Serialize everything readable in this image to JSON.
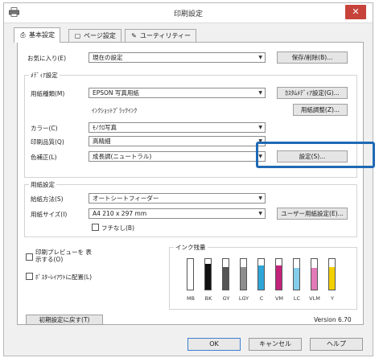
{
  "window": {
    "title": "印刷設定",
    "close_glyph": "✕"
  },
  "tabs": [
    {
      "label": "基本設定",
      "icon": "printer-icon"
    },
    {
      "label": "ページ設定",
      "icon": "page-icon"
    },
    {
      "label": "ユーティリティー",
      "icon": "wrench-icon"
    }
  ],
  "favorites": {
    "label": "お気に入り(E)",
    "value": "現在の設定",
    "save_button": "保存/削除(B)..."
  },
  "media": {
    "group_title": "ﾒﾃﾞｨｱ設定",
    "paper_type_label": "用紙種類(M)",
    "paper_type_value": "EPSON 写真用紙",
    "custom_media_button": "ｶｽﾀﾑﾒﾃﾞｨｱ設定(G)...",
    "sub_label": "ｲﾝｸｼｮｯﾄﾌﾞﾗｯｸｲﾝｸ",
    "paper_adjust_button": "用紙調整(Z)...",
    "color_label": "カラー(C)",
    "color_value": "ﾓﾉｸﾛ写真",
    "quality_label": "印刷品質(Q)",
    "quality_value": "高精細",
    "correction_label": "色補正(L)",
    "correction_value": "成長調(ニュートラル)",
    "settings_button": "設定(S)..."
  },
  "paper": {
    "group_title": "用紙設定",
    "feed_label": "給紙方法(S)",
    "feed_value": "オートシートフィーダー",
    "size_label": "用紙サイズ(I)",
    "size_value": "A4 210 x 297 mm",
    "user_size_button": "ユーザー用紙設定(E)...",
    "borderless_label": "フチなし(B)"
  },
  "options": {
    "preview_label": "印刷プレビューを 表示する(O)",
    "layout_label": "ﾎﾟｽﾀｰﾚｲｱｳﾄに配置(L)"
  },
  "ink": {
    "title": "インク残量",
    "cartridges": [
      {
        "name": "MB",
        "color": "#222222",
        "level": 0
      },
      {
        "name": "BK",
        "color": "#111111",
        "level": 0.85
      },
      {
        "name": "GY",
        "color": "#555555",
        "level": 0.75
      },
      {
        "name": "LGY",
        "color": "#8d8d8d",
        "level": 0.75
      },
      {
        "name": "C",
        "color": "#2fa6d8",
        "level": 0.8
      },
      {
        "name": "VM",
        "color": "#c2237b",
        "level": 0.8
      },
      {
        "name": "LC",
        "color": "#85cdea",
        "level": 0.7
      },
      {
        "name": "VLM",
        "color": "#e27bb8",
        "level": 0.7
      },
      {
        "name": "Y",
        "color": "#f3d100",
        "level": 0.75
      }
    ]
  },
  "footer": {
    "reset_button": "初期設定に戻す(T)",
    "version": "Version 6.70",
    "ok": "OK",
    "cancel": "キャンセル",
    "help": "ヘルプ"
  }
}
